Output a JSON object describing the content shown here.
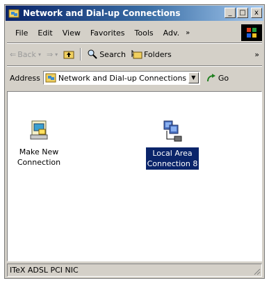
{
  "window": {
    "title": "Network and Dial-up Connections",
    "buttons": {
      "minimize": "_",
      "maximize": "□",
      "close": "x"
    }
  },
  "menubar": {
    "items": [
      "File",
      "Edit",
      "View",
      "Favorites",
      "Tools",
      "Adv."
    ],
    "overflow": "»"
  },
  "toolbar": {
    "back": "Back",
    "search": "Search",
    "folders": "Folders",
    "overflow": "»"
  },
  "addressbar": {
    "label": "Address",
    "value": "Network and Dial-up Connections",
    "go": "Go"
  },
  "content": {
    "items": [
      {
        "label_line1": "Make New",
        "label_line2": "Connection",
        "icon": "make-new-connection-icon",
        "selected": false
      },
      {
        "label_line1": "Local Area",
        "label_line2": "Connection 8",
        "icon": "network-computers-icon",
        "selected": true
      }
    ]
  },
  "statusbar": {
    "text": "ITeX ADSL PCI NIC"
  },
  "colors": {
    "titlebar_start": "#0a246a",
    "titlebar_end": "#a6caf0",
    "selection": "#0a246a",
    "chrome": "#d4d0c8"
  }
}
